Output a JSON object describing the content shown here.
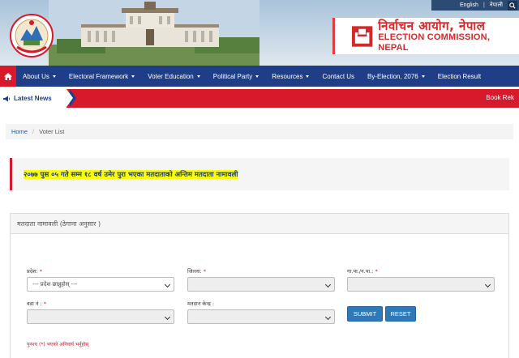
{
  "header": {
    "lang_english": "English",
    "lang_separator": "|",
    "lang_nepali": "नेपाली",
    "ec_name_np": "निर्वाचन आयोग, नेपाल",
    "ec_name_en": "ELECTION COMMISSION, NEPAL"
  },
  "nav": {
    "items": [
      {
        "label": "About Us",
        "dropdown": true
      },
      {
        "label": "Electoral Framework",
        "dropdown": true
      },
      {
        "label": "Voter Education",
        "dropdown": true
      },
      {
        "label": "Political Party",
        "dropdown": true
      },
      {
        "label": "Resources",
        "dropdown": true
      },
      {
        "label": "Contact Us",
        "dropdown": false
      },
      {
        "label": "By-Election, 2076",
        "dropdown": true
      },
      {
        "label": "Election Result",
        "dropdown": false
      }
    ]
  },
  "ticker": {
    "label": "Latest News",
    "text": "Book Rek"
  },
  "breadcrumb": {
    "home": "Home",
    "separator": "/",
    "current": "Voter List"
  },
  "alert": {
    "text": "२०७७ पुस ०५ गते सम्म १८ वर्ष उमेर पुरा भएका मतदाताको अन्तिम मतदाता नामावली"
  },
  "form": {
    "title": "मतदाता नामावली (ठेगाना अनुसार )",
    "province_label": "प्रदेश:",
    "province_placeholder": "--- प्रदेश छान्नुहोस् ---",
    "district_label": "जिल्ला:",
    "municipality_label": "गा.पा./न.पा.:",
    "ward_label": "वडा नं :",
    "polling_center_label": "मतदान केन्द्र :",
    "required_mark": "*",
    "submit_label": "SUBMIT",
    "reset_label": "RESET",
    "note": "पुनश्च (*) भएको अनिवार्य भर्नुहोस्"
  },
  "colors": {
    "navbar": "#1e3f88",
    "accent_red": "#d7192b",
    "button_blue": "#2f79b9",
    "alert_highlight": "#ffff00"
  }
}
